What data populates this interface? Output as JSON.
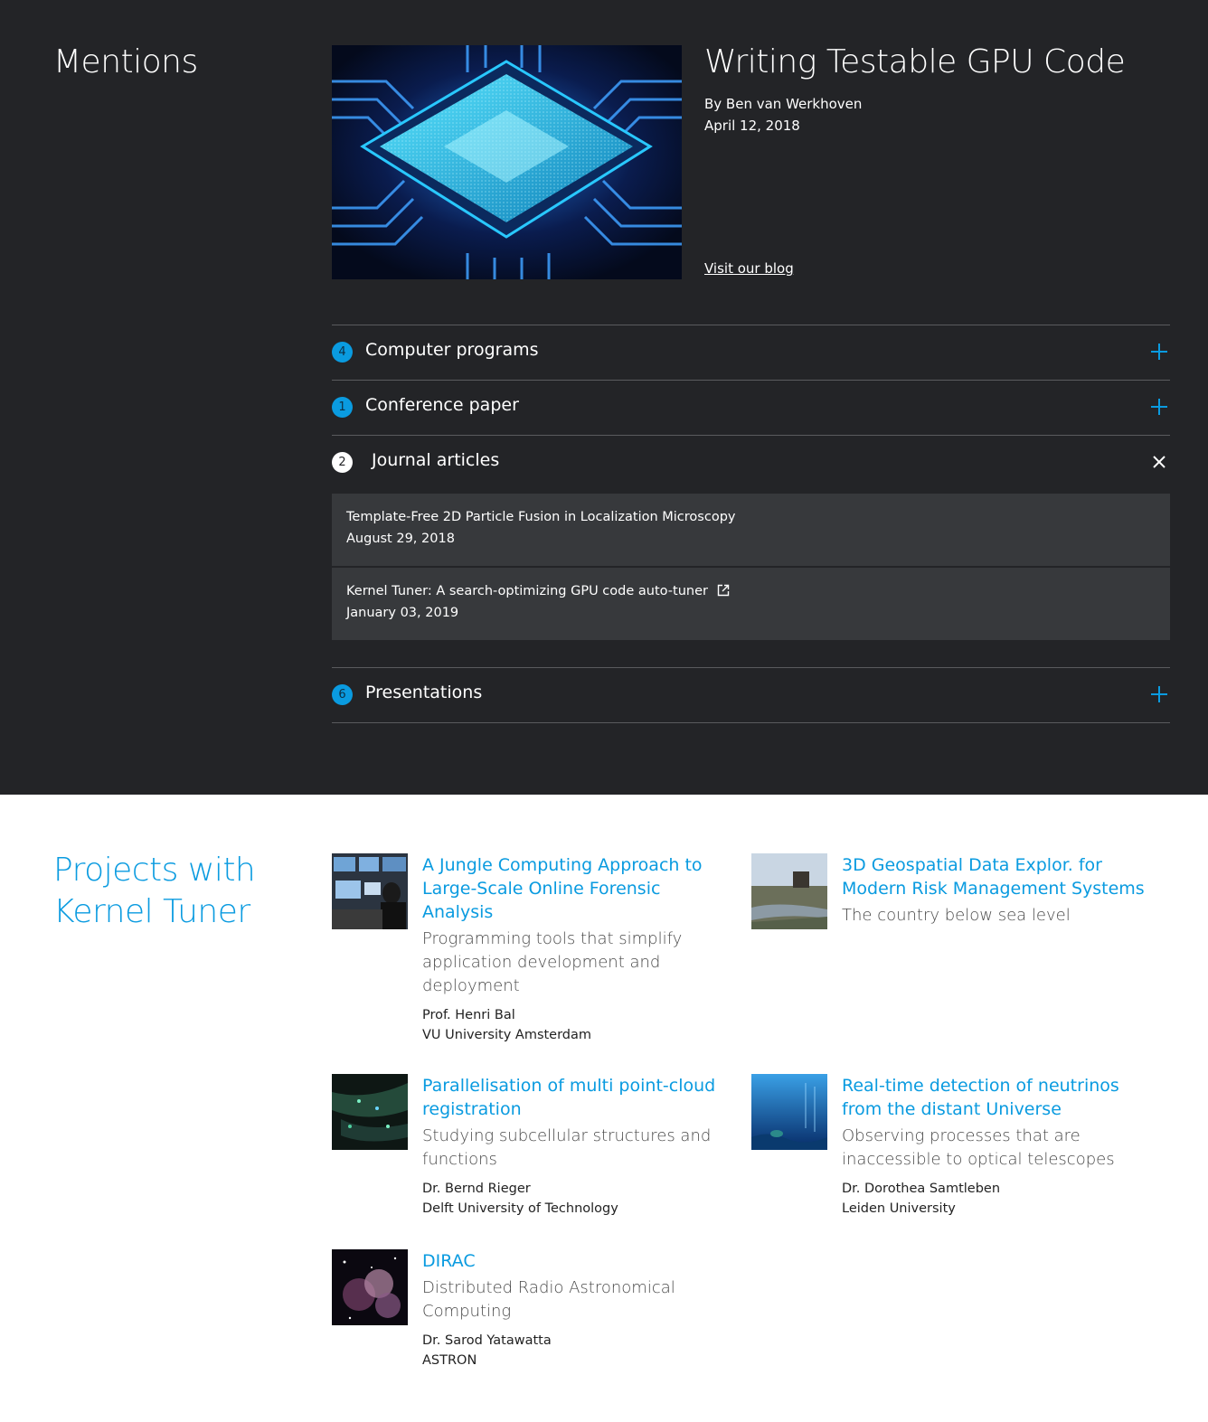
{
  "mentions": {
    "heading": "Mentions",
    "blog": {
      "image_alt": "gpu-chip-image",
      "title": "Writing Testable GPU Code",
      "author": "By Ben van Werkhoven",
      "date": "April 12, 2018",
      "link_label": "Visit our blog"
    },
    "accordion": [
      {
        "count": "4",
        "label": "Computer programs",
        "state": "collapsed",
        "toggle_icon": "plus-icon"
      },
      {
        "count": "1",
        "label": "Conference paper",
        "state": "collapsed",
        "toggle_icon": "plus-icon"
      },
      {
        "count": "2",
        "label": "Journal articles",
        "state": "expanded",
        "toggle_icon": "close-icon",
        "items": [
          {
            "title": "Template-Free 2D Particle Fusion in Localization Microscopy",
            "date": "August 29, 2018"
          },
          {
            "title": "Kernel Tuner: A search-optimizing GPU code auto-tuner",
            "date": "January 03, 2019",
            "icon": "external-link-icon"
          }
        ]
      },
      {
        "count": "6",
        "label": "Presentations",
        "state": "collapsed",
        "toggle_icon": "plus-icon"
      }
    ]
  },
  "projects": {
    "heading_line1": "Projects with",
    "heading_line2": "Kernel Tuner",
    "items": [
      {
        "title_lines": [
          "A Jungle Computing Approach to",
          "Large-Scale Online Forensic",
          "Analysis"
        ],
        "desc_lines": [
          "Programming tools that simplify",
          "application development and",
          "deployment"
        ],
        "person": "Prof. Henri Bal",
        "org": "VU University Amsterdam"
      },
      {
        "title_lines": [
          "3D Geospatial Data Explor. for",
          "Modern Risk Management Systems"
        ],
        "desc_lines": [
          "The country below sea level"
        ],
        "person": "",
        "org": ""
      },
      {
        "title_lines": [
          "Parallelisation of multi point-cloud",
          "registration"
        ],
        "desc_lines": [
          "Studying subcellular structures and",
          "functions"
        ],
        "person": "Dr. Bernd Rieger",
        "org": "Delft University of Technology"
      },
      {
        "title_lines": [
          "Real-time detection of neutrinos",
          "from the distant Universe"
        ],
        "desc_lines": [
          "Observing processes that are",
          "inaccessible to optical telescopes"
        ],
        "person": "Dr. Dorothea Samtleben",
        "org": "Leiden University"
      },
      {
        "title_lines": [
          "DIRAC"
        ],
        "desc_lines": [
          "Distributed Radio Astronomical",
          "Computing"
        ],
        "person": "Dr. Sarod Yatawatta",
        "org": "ASTRON"
      }
    ]
  },
  "colors": {
    "accent": "#0a9be0",
    "dark_bg": "#232427",
    "panel_bg": "#37393c"
  }
}
